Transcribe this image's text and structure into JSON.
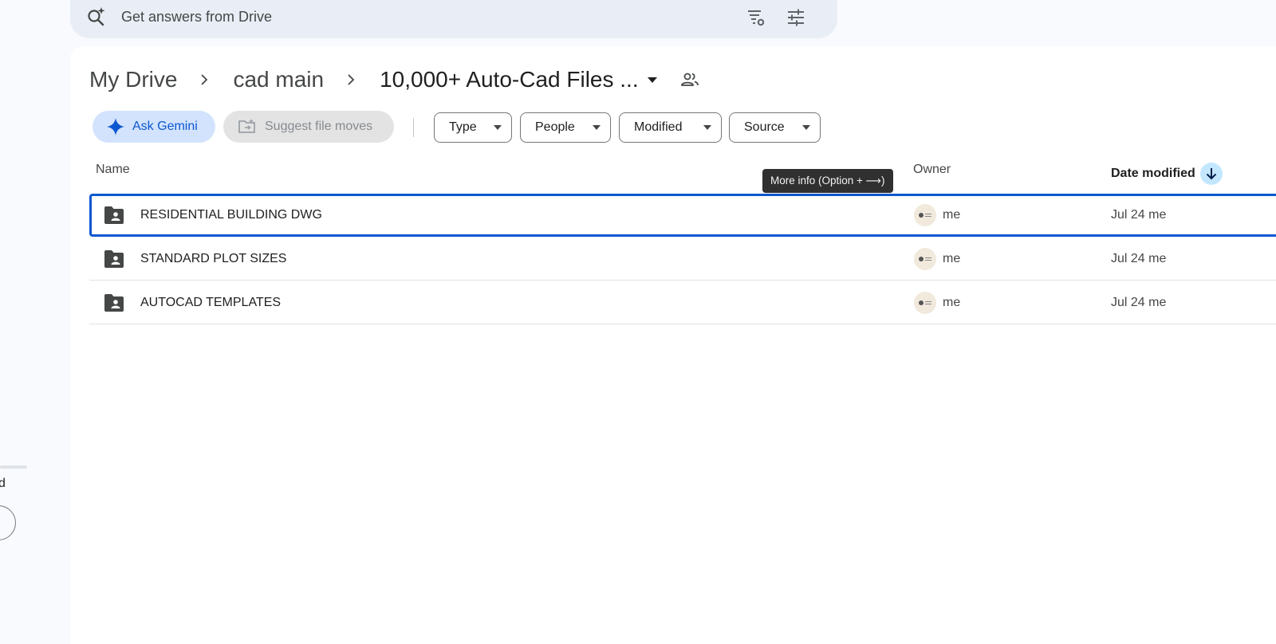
{
  "search": {
    "placeholder": "Get answers from Drive",
    "icons": [
      "search-spark-icon",
      "drive-settings-icon",
      "search-options-icon"
    ]
  },
  "breadcrumb": {
    "items": [
      "My Drive",
      "cad main"
    ],
    "current": "10,000+ Auto-Cad Files ...",
    "icons": [
      "chevron-right-icon",
      "dropdown-caret-icon",
      "shared-people-icon"
    ]
  },
  "actions": {
    "ask_gemini": "Ask Gemini",
    "suggest_moves": "Suggest file moves"
  },
  "filters": [
    "Type",
    "People",
    "Modified",
    "Source"
  ],
  "table": {
    "columns": {
      "name": "Name",
      "owner": "Owner",
      "date_modified": "Date modified"
    },
    "sort": "descending",
    "rows": [
      {
        "name": "RESIDENTIAL BUILDING DWG",
        "owner": "me",
        "date": "Jul 24 me",
        "selected": true
      },
      {
        "name": "STANDARD PLOT SIZES",
        "owner": "me",
        "date": "Jul 24 me",
        "selected": false
      },
      {
        "name": "AUTOCAD TEMPLATES",
        "owner": "me",
        "date": "Jul 24 me",
        "selected": false
      }
    ]
  },
  "tooltip": "More info (Option + ⟶)",
  "sidebar_partial": {
    "text": "d"
  },
  "colors": {
    "accent": "#0b57d0",
    "gemini_chip_bg": "#d3e3fd",
    "search_bg": "#e9eef6",
    "page_bg": "#f8fafd",
    "sort_bg": "#c2e7ff"
  }
}
